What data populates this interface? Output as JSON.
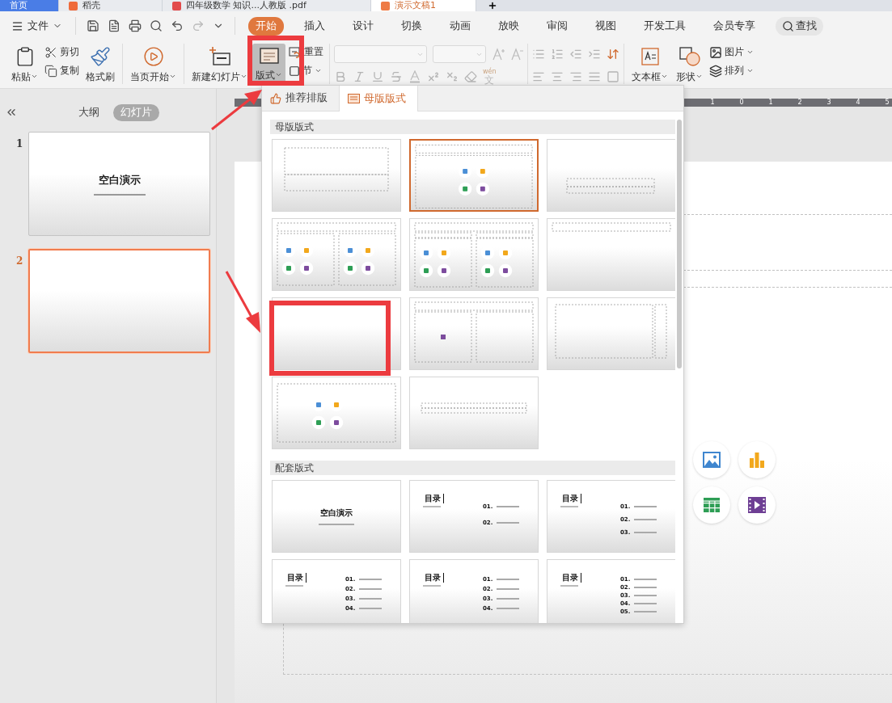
{
  "doc_tabs": [
    {
      "label": "首页",
      "kind": "home",
      "selected": false
    },
    {
      "label": "稻壳",
      "kind": "docer",
      "selected": false
    },
    {
      "label": "四年级数学 知识...人教版 .pdf",
      "kind": "pdf",
      "selected": false
    },
    {
      "label": "演示文稿1",
      "kind": "ppt",
      "selected": true
    }
  ],
  "file_menu": "文件",
  "ribbon_tabs": [
    {
      "label": "开始",
      "selected": true
    },
    {
      "label": "插入",
      "selected": false
    },
    {
      "label": "设计",
      "selected": false
    },
    {
      "label": "切换",
      "selected": false
    },
    {
      "label": "动画",
      "selected": false
    },
    {
      "label": "放映",
      "selected": false
    },
    {
      "label": "审阅",
      "selected": false
    },
    {
      "label": "视图",
      "selected": false
    },
    {
      "label": "开发工具",
      "selected": false
    },
    {
      "label": "会员专享",
      "selected": false
    }
  ],
  "search": "查找",
  "ribbon": {
    "paste": "粘贴",
    "cut": "剪切",
    "copy": "复制",
    "format_painter": "格式刷",
    "play": "当页开始",
    "new_slide": "新建幻灯片",
    "layout": {
      "label": "版式",
      "pressed": true
    },
    "reset": "重置",
    "section": "节",
    "phonetic": {
      "top": "wén",
      "char": "文"
    },
    "textbox": "文本框",
    "shape": "形状",
    "picture": "图片",
    "arrange": "排列"
  },
  "view_tabs": [
    {
      "label": "大纲",
      "selected": false
    },
    {
      "label": "幻灯片",
      "selected": true
    }
  ],
  "slides": [
    {
      "number": "1",
      "title": "空白演示",
      "selected": false
    },
    {
      "number": "2",
      "selected": true
    }
  ],
  "ruler": [
    "1",
    "0",
    "1",
    "2",
    "3",
    "4",
    "5"
  ],
  "layout_menu": {
    "tabs": [
      {
        "label": "推荐排版",
        "kind": "recommend",
        "selected": false
      },
      {
        "label": "母版版式",
        "kind": "master",
        "selected": true
      }
    ],
    "sections": [
      {
        "title": "母版版式",
        "items": [
          {
            "kind": "title",
            "selected": false
          },
          {
            "kind": "title-content",
            "selected": true
          },
          {
            "kind": "section",
            "selected": false
          },
          {
            "kind": "two-content",
            "selected": false
          },
          {
            "kind": "comparison",
            "selected": false
          },
          {
            "kind": "title-only",
            "selected": false
          },
          {
            "kind": "blank",
            "selected": false
          },
          {
            "kind": "content-caption",
            "selected": false
          },
          {
            "kind": "vertical",
            "selected": false
          },
          {
            "kind": "content",
            "selected": false
          },
          {
            "kind": "caption-bar",
            "selected": false
          }
        ]
      },
      {
        "title": "配套版式",
        "items": [
          {
            "kind": "cover",
            "title": "空白演示",
            "selected": false
          },
          {
            "kind": "toc",
            "title": "目录",
            "entries": [
              "01.",
              "02."
            ],
            "selected": false
          },
          {
            "kind": "toc",
            "title": "目录",
            "entries": [
              "01.",
              "02.",
              "03."
            ],
            "selected": false
          },
          {
            "kind": "toc",
            "title": "目录",
            "entries": [
              "01.",
              "02.",
              "03.",
              "04."
            ],
            "selected": false
          },
          {
            "kind": "toc",
            "title": "目录",
            "entries": [
              "01.",
              "02.",
              "03.",
              "04."
            ],
            "selected": false
          },
          {
            "kind": "toc",
            "title": "目录",
            "entries": [
              "01.",
              "02.",
              "03.",
              "04.",
              "05."
            ],
            "selected": false
          }
        ]
      }
    ]
  }
}
